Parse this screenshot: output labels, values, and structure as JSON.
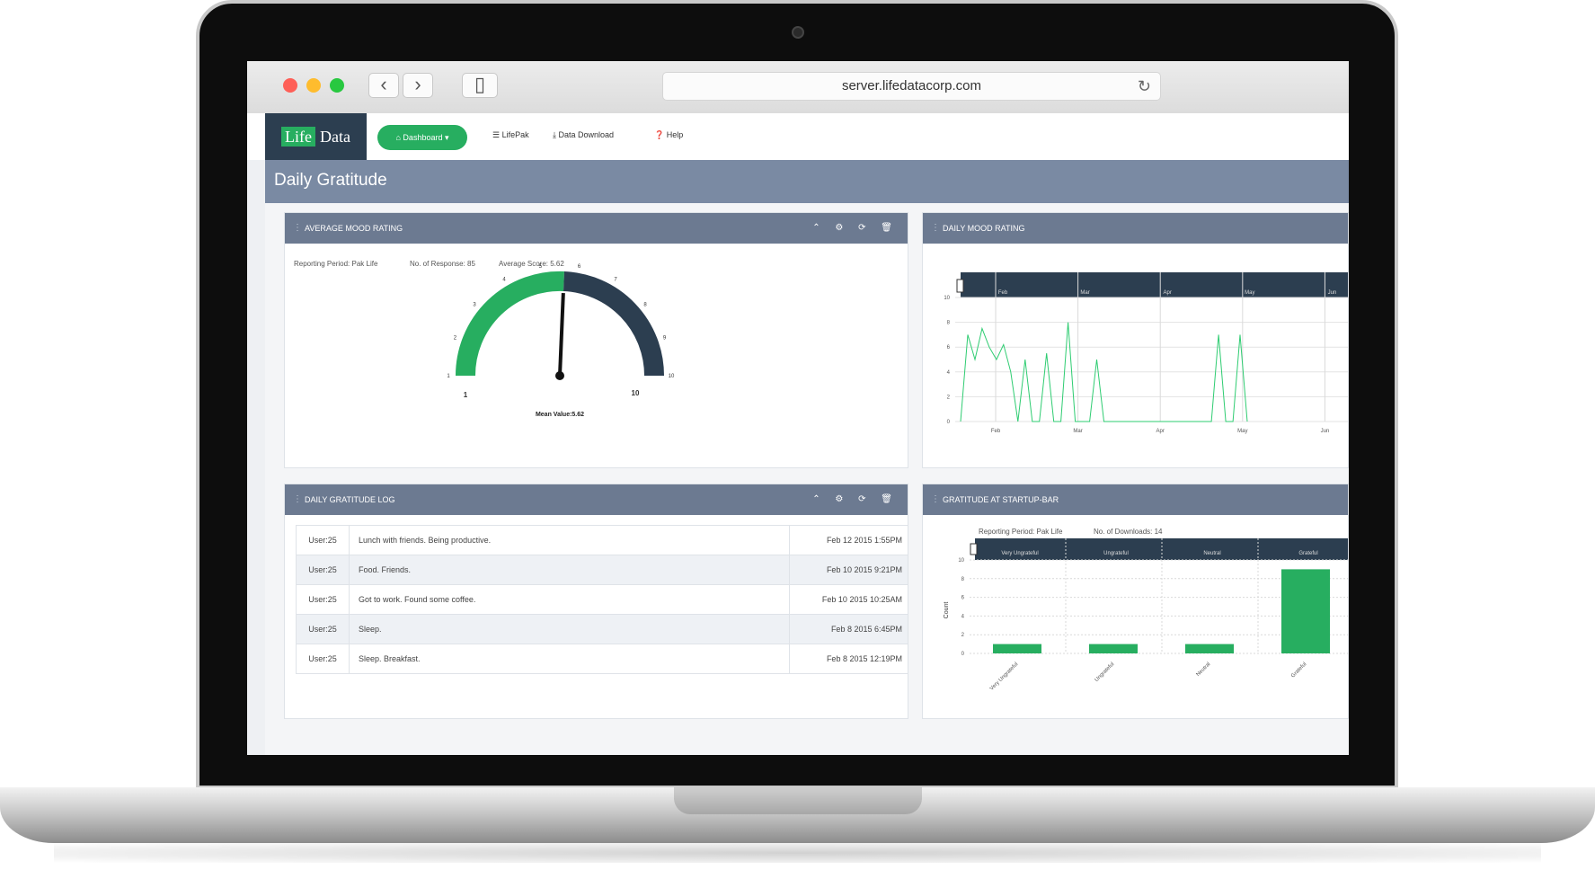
{
  "browser": {
    "url": "server.lifedatacorp.com",
    "back_icon": "‹",
    "forward_icon": "›",
    "sidebar_icon": "▯",
    "reload_icon": "↻"
  },
  "nav": {
    "logo_life": "Life",
    "logo_data": "Data",
    "dashboard": "⌂ Dashboard ▾",
    "lifepak": "☰ LifePak",
    "download": "⤓ Data Download",
    "help": "❓ Help"
  },
  "page": {
    "title": "Daily Gratitude"
  },
  "panels": {
    "mood": {
      "title": "AVERAGE MOOD RATING",
      "period": "Reporting Period: Pak Life",
      "responses": "No. of Response: 85",
      "avg": "Average Score: 5.62",
      "mean_label": "Mean Value:5.62",
      "min_label": "1",
      "max_label": "10"
    },
    "daily": {
      "title": "DAILY MOOD RATING"
    },
    "log": {
      "title": "DAILY GRATITUDE LOG"
    },
    "bar": {
      "title": "GRATITUDE AT STARTUP-BAR",
      "period": "Reporting Period: Pak Life",
      "downloads": "No. of Downloads: 14"
    }
  },
  "tools": "⌃ ⚙ ⟳ 🗑",
  "log_rows": [
    {
      "user": "User:25",
      "text": "Lunch with friends. Being productive.",
      "time": "Feb 12 2015 1:55PM"
    },
    {
      "user": "User:25",
      "text": "Food. Friends.",
      "time": "Feb 10 2015 9:21PM"
    },
    {
      "user": "User:25",
      "text": "Got to work. Found some coffee.",
      "time": "Feb 10 2015 10:25AM"
    },
    {
      "user": "User:25",
      "text": "Sleep.",
      "time": "Feb 8 2015 6:45PM"
    },
    {
      "user": "User:25",
      "text": "Sleep. Breakfast.",
      "time": "Feb 8 2015 12:19PM"
    }
  ],
  "colors": {
    "accent": "#27ae60",
    "navy": "#2c3e50",
    "header": "#7a8aa3",
    "panel_head": "#6c7a91"
  },
  "chart_data": [
    {
      "type": "gauge",
      "value": 5.62,
      "min": 1,
      "max": 10,
      "ticks": [
        "1",
        "2",
        "3",
        "4",
        "5",
        "6",
        "7",
        "8",
        "9",
        "10"
      ],
      "colors": [
        "#27ae60",
        "#2c3e50"
      ]
    },
    {
      "type": "line",
      "x_ticks": [
        "Feb",
        "Mar",
        "Apr",
        "May",
        "Jun"
      ],
      "y_ticks": [
        "0",
        "2",
        "4",
        "6",
        "8",
        "10"
      ],
      "ylim": [
        0,
        10
      ],
      "color": "#27ae60",
      "series": [
        {
          "x": [
            0,
            0.1,
            0.2,
            0.3,
            0.4,
            0.5,
            0.6,
            0.7,
            0.8,
            0.9,
            1.0,
            1.1,
            1.2,
            1.3,
            1.4,
            1.5,
            1.6,
            1.7,
            1.8,
            1.9,
            2.0,
            2.1,
            2.2,
            2.3,
            2.4,
            2.5,
            2.6,
            2.7,
            2.8,
            2.9,
            3.0,
            3.1,
            3.2,
            3.3,
            3.4,
            3.5,
            3.6,
            3.7,
            3.8,
            3.9,
            4.0
          ],
          "y": [
            0,
            7,
            5,
            7.5,
            6,
            5,
            6.2,
            4,
            0,
            5,
            0,
            0,
            5.5,
            0,
            0,
            8,
            0,
            0,
            0,
            5,
            0,
            0,
            0,
            0,
            0,
            0,
            0,
            0,
            0,
            0,
            0,
            0,
            0,
            0,
            0,
            0,
            7,
            0,
            0,
            7,
            0
          ]
        }
      ]
    },
    {
      "type": "bar",
      "categories": [
        "Very Ungrateful",
        "Ungrateful",
        "Neutral",
        "Grateful"
      ],
      "values": [
        1,
        1,
        1,
        9
      ],
      "ylabel": "Count",
      "y_ticks": [
        "0",
        "2",
        "4",
        "6",
        "8",
        "10"
      ],
      "ylim": [
        0,
        10
      ],
      "color": "#27ae60"
    }
  ]
}
